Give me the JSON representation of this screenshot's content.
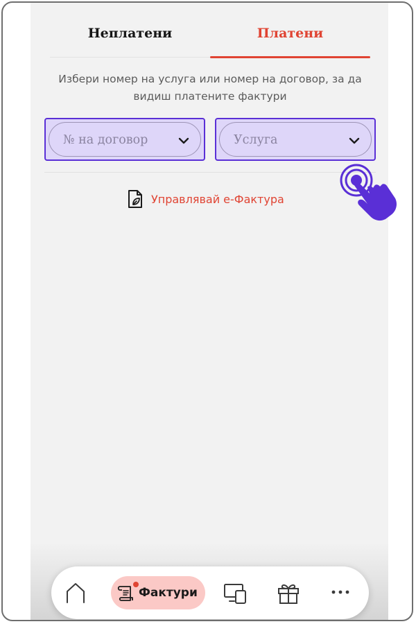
{
  "tabs": [
    {
      "label": "Неплатени",
      "active": false
    },
    {
      "label": "Платени",
      "active": true
    }
  ],
  "instruction": {
    "line1": "Избери номер на услуга или номер на договор, за да",
    "line2": "видиш платените фактури"
  },
  "dropdowns": {
    "contract": {
      "placeholder": "№ на договор",
      "icon": "chevron-down-icon"
    },
    "service": {
      "placeholder": "Услуга",
      "icon": "chevron-down-icon"
    }
  },
  "einvoice": {
    "label": "Управлявай е-Фактура",
    "icon": "document-leaf-icon"
  },
  "bottom_nav": {
    "items": [
      {
        "name": "home",
        "icon": "home-icon"
      },
      {
        "name": "invoices",
        "label": "Фактури",
        "icon": "invoice-scroll-icon",
        "active": true,
        "notification": true
      },
      {
        "name": "devices",
        "icon": "devices-icon"
      },
      {
        "name": "gift",
        "icon": "gift-icon"
      },
      {
        "name": "more",
        "icon": "more-dots-icon"
      }
    ]
  },
  "colors": {
    "accent": "#e04433",
    "highlight": "#5a2fd6",
    "highlight_fill": "#ded6f9",
    "active_nav_pill": "#fbc9c6",
    "background": "#f2f2f2"
  }
}
